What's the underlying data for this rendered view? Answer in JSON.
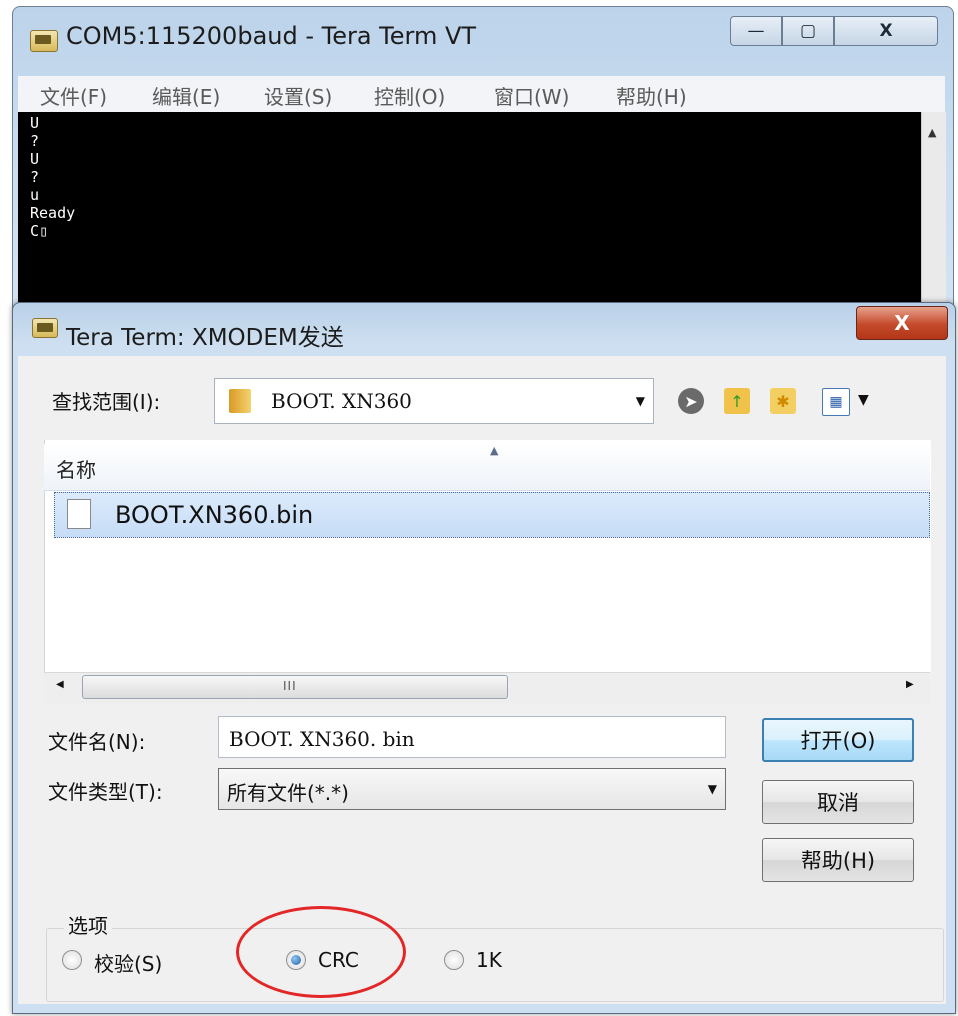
{
  "main_window": {
    "title": "COM5:115200baud - Tera Term VT",
    "controls": {
      "minimize": "—",
      "maximize": "▢",
      "close": "X"
    },
    "menu": [
      "文件(F)",
      "编辑(E)",
      "设置(S)",
      "控制(O)",
      "窗口(W)",
      "帮助(H)"
    ],
    "terminal_text": "U\n?\nU\n?\nu\nReady\nC▯"
  },
  "dialog": {
    "title": "Tera Term: XMODEM发送",
    "close": "X",
    "look_in": {
      "label": "查找范围(I):",
      "value": "BOOT. XN360"
    },
    "toolbar_icons": [
      "back-icon",
      "up-folder-icon",
      "new-folder-icon",
      "view-menu-icon"
    ],
    "file_list": {
      "column": "名称",
      "files": [
        "BOOT.XN360.bin"
      ]
    },
    "scrollbar": {
      "left": "◀",
      "right": "▶",
      "grip": "III"
    },
    "filename": {
      "label": "文件名(N):",
      "value": "BOOT. XN360. bin"
    },
    "filetype": {
      "label": "文件类型(T):",
      "value": "所有文件(*.*)"
    },
    "buttons": {
      "open": "打开(O)",
      "cancel": "取消",
      "help": "帮助(H)"
    },
    "options": {
      "label": "选项",
      "choices": [
        {
          "label": "校验(S)",
          "checked": false
        },
        {
          "label": "CRC",
          "checked": true
        },
        {
          "label": "1K",
          "checked": false
        }
      ]
    }
  },
  "annotation": {
    "color": "#e32626"
  }
}
